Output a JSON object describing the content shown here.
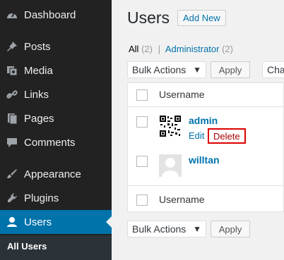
{
  "sidebar": {
    "items": [
      {
        "label": "Dashboard",
        "icon": "dashboard-icon"
      },
      {
        "label": "Posts",
        "icon": "pushpin-icon"
      },
      {
        "label": "Media",
        "icon": "media-icon"
      },
      {
        "label": "Links",
        "icon": "link-icon"
      },
      {
        "label": "Pages",
        "icon": "page-icon"
      },
      {
        "label": "Comments",
        "icon": "comment-icon"
      },
      {
        "label": "Appearance",
        "icon": "paintbrush-icon"
      },
      {
        "label": "Plugins",
        "icon": "plug-icon"
      },
      {
        "label": "Users",
        "icon": "user-icon",
        "active": true
      }
    ],
    "submenu": {
      "label": "All Users"
    }
  },
  "page": {
    "title": "Users",
    "add_new": "Add New",
    "views": {
      "all_label": "All",
      "all_count": "(2)",
      "separator": "|",
      "admin_label": "Administrator",
      "admin_count": "(2)"
    },
    "bulk_top": "Bulk Actions",
    "apply_top": "Apply",
    "change_role_partial": "Cha",
    "bulk_bottom": "Bulk Actions",
    "apply_bottom": "Apply"
  },
  "table": {
    "header_username": "Username",
    "footer_username": "Username",
    "rows": [
      {
        "username": "admin",
        "edit": "Edit",
        "delete": "Delete"
      },
      {
        "username": "willtan"
      }
    ]
  },
  "colors": {
    "accent": "#0073aa",
    "delete_outline": "#d00"
  }
}
